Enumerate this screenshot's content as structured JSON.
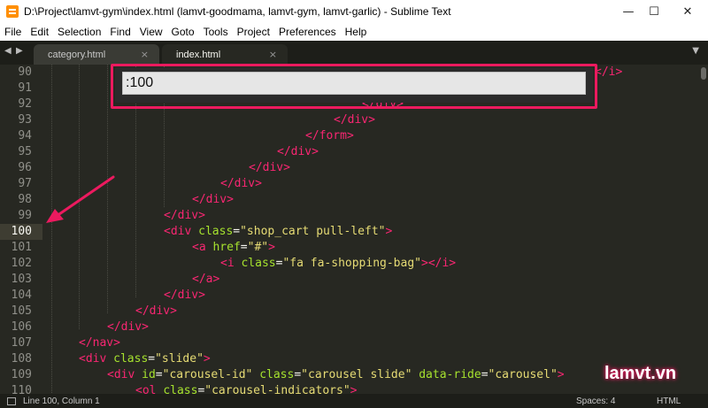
{
  "window": {
    "title": "D:\\Project\\lamvt-gym\\index.html (lamvt-goodmama, lamvt-gym, lamvt-garlic) - Sublime Text",
    "minimize": "—",
    "maximize": "☐",
    "close": "✕"
  },
  "menu": [
    "File",
    "Edit",
    "Selection",
    "Find",
    "View",
    "Goto",
    "Tools",
    "Project",
    "Preferences",
    "Help"
  ],
  "tabs": [
    {
      "label": "category.html",
      "close": "×"
    },
    {
      "label": "index.html",
      "close": "×"
    }
  ],
  "tab_nav": {
    "left": "◀",
    "right": "▶",
    "dropdown": "▼"
  },
  "goto": {
    "value": ":100"
  },
  "line_numbers": [
    "90",
    "91",
    "92",
    "93",
    "94",
    "95",
    "96",
    "97",
    "98",
    "99",
    "100",
    "101",
    "102",
    "103",
    "104",
    "105",
    "106",
    "107",
    "108",
    "109",
    "110"
  ],
  "current_line": "100",
  "code_fragments": {
    "l90_end": "</i>",
    "l92": "</div>",
    "l93": "</div>",
    "l94": "</form>",
    "l95": "</div>",
    "l96": "</div>",
    "l97": "</div>",
    "l98": "</div>",
    "l99": "</div>",
    "l100": {
      "t1": "<div ",
      "a1": "class",
      "e1": "=",
      "s1": "\"shop_cart pull-left\"",
      "t2": ">"
    },
    "l101": {
      "t1": "<a ",
      "a1": "href",
      "e1": "=",
      "s1": "\"#\"",
      "t2": ">"
    },
    "l102": {
      "t1": "<i ",
      "a1": "class",
      "e1": "=",
      "s1": "\"fa fa-shopping-bag\"",
      "t2": "></i>"
    },
    "l103": "</a>",
    "l104": "</div>",
    "l105": "</div>",
    "l106": "</div>",
    "l107": "</nav>",
    "l108": {
      "t1": "<div ",
      "a1": "class",
      "e1": "=",
      "s1": "\"slide\"",
      "t2": ">"
    },
    "l109": {
      "t1": "<div ",
      "a1": "id",
      "e1": "=",
      "s1": "\"carousel-id\"",
      "sp1": " ",
      "a2": "class",
      "e2": "=",
      "s2": "\"carousel slide\"",
      "sp2": " ",
      "a3": "data-ride",
      "e3": "=",
      "s3": "\"carousel\"",
      "t2": ">"
    },
    "l110": {
      "t1": "<ol ",
      "a1": "class",
      "e1": "=",
      "s1": "\"carousel-indicators\"",
      "t2": ">"
    }
  },
  "watermark": "lamvt.vn",
  "status": {
    "position": "Line 100, Column 1",
    "spaces": "Spaces: 4",
    "syntax": "HTML"
  },
  "colors": {
    "background": "#272822",
    "tag": "#f92672",
    "attribute": "#a6e22e",
    "string": "#e6db74",
    "highlight": "#ec1a5f"
  }
}
